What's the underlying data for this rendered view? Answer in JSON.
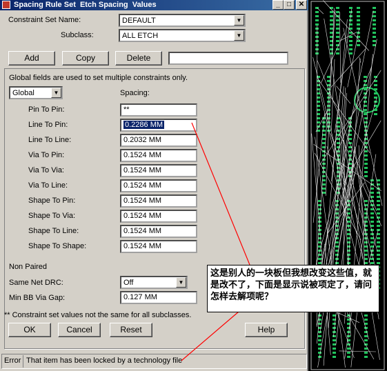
{
  "window": {
    "title": "Spacing Rule Set  Etch Spacing  Values",
    "controls": {
      "minimize": "_",
      "maximize": "□",
      "close": "✕"
    }
  },
  "constraint_set": {
    "label": "Constraint Set Name:",
    "value": "DEFAULT"
  },
  "subclass": {
    "label": "Subclass:",
    "value": "ALL ETCH"
  },
  "actions": {
    "add": "Add",
    "copy": "Copy",
    "delete": "Delete",
    "name_input_value": ""
  },
  "global_note": "Global fields are used to set multiple constraints only.",
  "scope": {
    "value": "Global"
  },
  "spacing_header": "Spacing:",
  "rules": [
    {
      "label": "Pin To Pin:",
      "value": "**"
    },
    {
      "label": "Line To Pin:",
      "value": "0.2286 MM"
    },
    {
      "label": "Line To Line:",
      "value": "0.2032 MM"
    },
    {
      "label": "Via To Pin:",
      "value": "0.1524 MM"
    },
    {
      "label": "Via To Via:",
      "value": "0.1524 MM"
    },
    {
      "label": "Via To Line:",
      "value": "0.1524 MM"
    },
    {
      "label": "Shape To Pin:",
      "value": "0.1524 MM"
    },
    {
      "label": "Shape To Via:",
      "value": "0.1524 MM"
    },
    {
      "label": "Shape To Line:",
      "value": "0.1524 MM"
    },
    {
      "label": "Shape To Shape:",
      "value": "0.1524 MM"
    }
  ],
  "non_paired": {
    "heading": "Non Paired",
    "same_net_label": "Same Net DRC:",
    "same_net_value": "Off",
    "min_bb_label": "Min BB Via Gap:",
    "min_bb_value": "0.127 MM"
  },
  "footnote": "** Constraint set values not the same for all subclasses.",
  "buttons": {
    "ok": "OK",
    "cancel": "Cancel",
    "reset": "Reset",
    "help": "Help"
  },
  "status": {
    "type": "Error",
    "message": "That item has been locked by a technology file"
  },
  "annotation": {
    "text": "这是别人的一块板但我想改变这些值，就是改不了，下面是显示说被项定了，请问怎样去解项呢？",
    "color": "#ff0000"
  },
  "colors": {
    "pcb_green": "#22c55e",
    "pcb_bg": "#000000",
    "title_blue": "#0a246a"
  }
}
